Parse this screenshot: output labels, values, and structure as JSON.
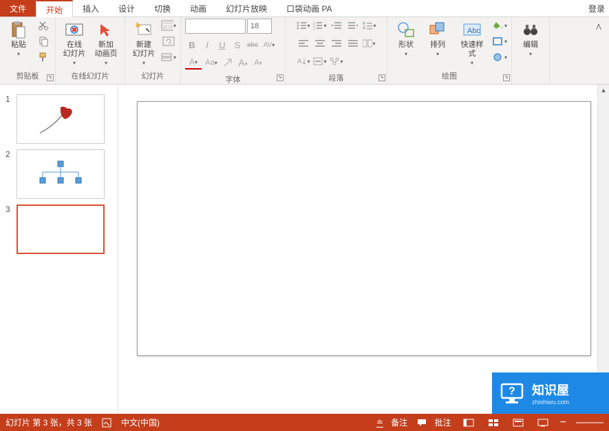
{
  "tabs": {
    "file": "文件",
    "home": "开始",
    "insert": "插入",
    "design": "设计",
    "transition": "切换",
    "animation": "动画",
    "slideshow": "幻灯片放映",
    "pocket": "口袋动画 PA"
  },
  "login": "登录",
  "groups": {
    "clipboard": "剪贴板",
    "online_slides": "在线幻灯片",
    "slides": "幻灯片",
    "font": "字体",
    "paragraph": "段落",
    "drawing": "绘图",
    "editing": "编辑"
  },
  "buttons": {
    "paste": "粘贴",
    "online_slide": "在线\n幻灯片",
    "new_anim": "新加\n动画页",
    "new_slide": "新建\n幻灯片",
    "shapes": "形状",
    "arrange": "排列",
    "quick_styles": "快速样式"
  },
  "font": {
    "name_placeholder": "",
    "size": "18",
    "bold": "B",
    "italic": "I",
    "underline": "U",
    "shadow": "S",
    "strike": "abc",
    "spacing": "AV",
    "fontcolor": "A",
    "textcase": "Aa",
    "grow": "A",
    "shrink": "A"
  },
  "thumbs": [
    {
      "num": "1"
    },
    {
      "num": "2"
    },
    {
      "num": "3"
    }
  ],
  "selected_slide": 3,
  "status": {
    "slide_info": "幻灯片 第 3 张，共 3 张",
    "language": "中文(中国)",
    "notes": "备注",
    "comments": "批注",
    "zoom_minus": "−"
  },
  "watermark": {
    "title": "知识屋",
    "url": "zhishiwu.com"
  }
}
